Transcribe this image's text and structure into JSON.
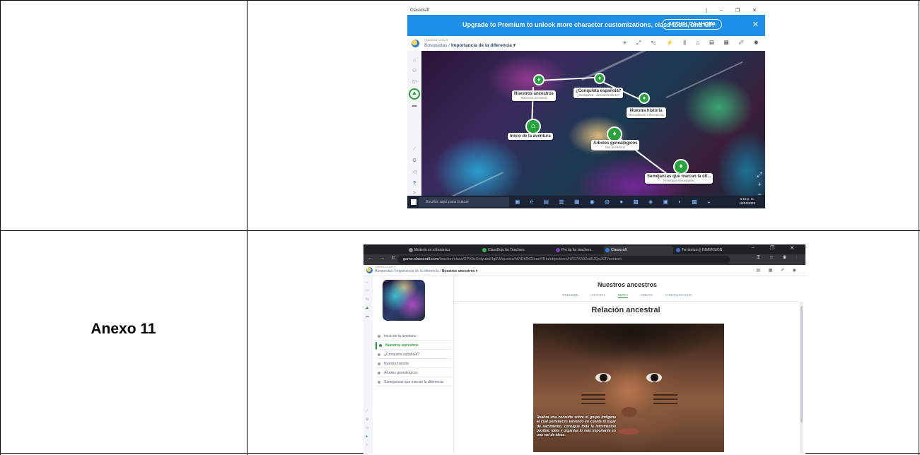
{
  "document": {
    "annex_label": "Anexo 11"
  },
  "screenshot1": {
    "window_title": "Classcraft",
    "window_controls": "| − ❐ ✕",
    "banner": {
      "message": "Upgrade to Premium to unlock more character customizations, class tools, and GP.",
      "button": "ACTUALIZA AHORA",
      "close": "✕"
    },
    "header": {
      "small_label": "QUERIDA CASE ▾",
      "crumb_root": "Búsquedas",
      "crumb_sep": " / ",
      "crumb_current": "Importancia de la diferencia ▾",
      "tools": [
        "+",
        "⤢",
        "✎",
        "⚡",
        "⫼",
        "⌂",
        "▤",
        "▦",
        "✐",
        "◉"
      ]
    },
    "sidebar_icons": [
      "⌂",
      "⚇",
      "⛫",
      "⛰",
      "▬",
      "⟋",
      "⚙",
      "◁",
      "?",
      ">"
    ],
    "map_nodes": [
      {
        "title": "Nuestros ancestros",
        "subtitle": "Relación ancestral"
      },
      {
        "title": "¿Conquista española?",
        "subtitle": "¿Conquista - descubrimiento?"
      },
      {
        "title": "Nuestra historia",
        "subtitle": "Recopilando información"
      },
      {
        "title": "Inicio de la aventura",
        "subtitle": ""
      },
      {
        "title": "Árboles genealógicos",
        "subtitle": "Mis ancestros"
      },
      {
        "title": "Semejanzas que marcan la dif...",
        "subtitle": "Fenotipos semejantes"
      }
    ],
    "zoom": {
      "expand": "⤢",
      "plus": "+",
      "minus": "−"
    },
    "taskbar": {
      "search_placeholder": "Escribe aquí para buscar",
      "time": "6:18 p. m.",
      "date": "18/04/2019",
      "lang": "ESP"
    }
  },
  "screenshot2": {
    "tabs": [
      {
        "label": "Misterio en el botánico",
        "color": "#8f8f8f"
      },
      {
        "label": "ClassDojo for Teachers",
        "color": "#33b24a"
      },
      {
        "label": "Pro tip for teachers",
        "color": "#7b3fbf"
      },
      {
        "label": "Classcraft",
        "color": "#2a7de1"
      },
      {
        "label": "Territorium || INMERSIÓN",
        "color": "#3a6fd8"
      }
    ],
    "window_controls": "− ❐ ✕",
    "url_host": "game.classcraft.com",
    "url_path": "/teacher/class/SPX6zXrdyubuHg5Ui/quests/hf7iDkRtGiear#HHu/objectives/hYE7X592sd5JQqJCF/content",
    "nav_icons": "← → C",
    "header": {
      "small_label": "QUERIDA CASE ▾",
      "crumb_root": "Búsquedas / Importancia de la diferencia / ",
      "crumb_current": "Nuestros ancestros ▾",
      "tools": "▤ ▦ ✐ ◉"
    },
    "objectives": [
      {
        "label": "Inicio de la aventura",
        "active": false
      },
      {
        "label": "Nuestros ancestros",
        "active": true
      },
      {
        "label": "¿Conquista española?",
        "active": false
      },
      {
        "label": "Nuestra historia",
        "active": false
      },
      {
        "label": "Árboles genealógicos",
        "active": false
      },
      {
        "label": "Semejanzas que marcan la diferencia",
        "active": false
      }
    ],
    "title": "Nuestros ancestros",
    "subtabs": [
      "RESUMEN",
      "HISTORIA",
      "TAREA",
      "DEBATE",
      "CONFIGURACIÓN"
    ],
    "active_subtab": "TAREA",
    "heading": "Relación ancestral",
    "caption": "Realiza una consulta sobre el grupo indígena al cual perteneces teniendo en cuenta tu lugar de nacimiento, consigue toda la información posible, idela y organiza lo más importante en una red de ideas."
  }
}
